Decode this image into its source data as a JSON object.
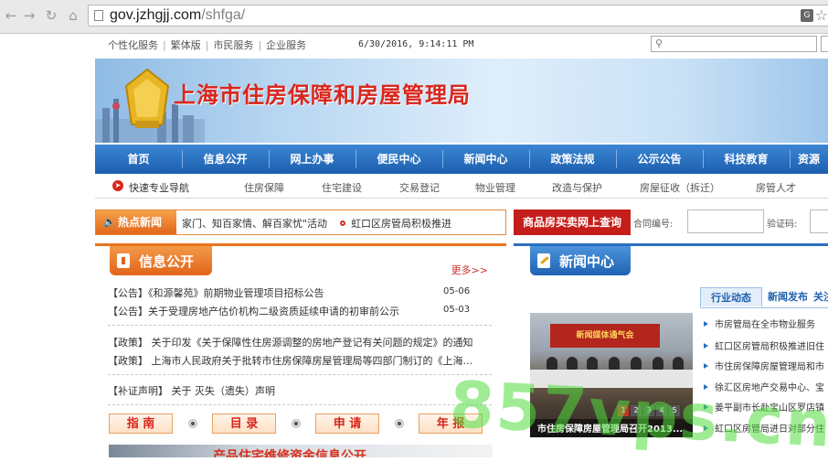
{
  "browser": {
    "url_host": "gov.jzhgjj.com",
    "url_path": "/shfga/",
    "translate_icon": "translate-icon",
    "star_icon": "star-icon"
  },
  "util": {
    "links": [
      "个性化服务",
      "繁体版",
      "市民服务",
      "企业服务"
    ],
    "date": "6/30/2016, 9:14:11 PM"
  },
  "banner": {
    "title": "上海市住房保障和房屋管理局"
  },
  "mainnav": [
    "首页",
    "信息公开",
    "网上办事",
    "便民中心",
    "新闻中心",
    "政策法规",
    "公示公告",
    "科技教育",
    "资源"
  ],
  "subnav": {
    "lead": "快速专业导航",
    "items": [
      "住房保障",
      "住宅建设",
      "交易登记",
      "物业管理",
      "改造与保护",
      "房屋征收（拆迁）",
      "房管人才"
    ]
  },
  "hot": {
    "label": "热点新闻",
    "text1": "家门、知百家情、解百家忧\"活动",
    "text2": "虹口区房管局积极推进"
  },
  "query": {
    "title": "商品房买卖网上查询",
    "contract_label": "合同编号:",
    "code_label": "验证码:"
  },
  "info": {
    "title": "信息公开",
    "more": "更多>>",
    "rows": [
      {
        "text": "【公告】《和源馨苑》前期物业管理项目招标公告",
        "date": "05-06"
      },
      {
        "text": "【公告】关于受理房地产估价机构二级资质延续申请的初审前公示",
        "date": "05-03"
      },
      {
        "text": "【政策】 关于印发《关于保障性住房源调整的房地产登记有关问题的规定》的通知",
        "date": ""
      },
      {
        "text": "【政策】 上海市人民政府关于批转市住房保障房屋管理局等四部门制订的《上海...",
        "date": ""
      },
      {
        "text": "【补证声明】 关于 灭失（遗失）声明",
        "date": ""
      }
    ],
    "buttons": [
      "指 南",
      "目 录",
      "申 请",
      "年 报"
    ],
    "banner2": "产品住宅维修资金信息公开"
  },
  "news": {
    "title": "新闻中心",
    "tabs": [
      "行业动态",
      "新闻发布",
      "关注"
    ],
    "photo_banner": "新闻媒体通气会",
    "photo_caption": "市住房保障房屋管理局召开2013...",
    "pager": [
      "1",
      "2",
      "3",
      "4",
      "5"
    ],
    "items": [
      "市房管局在全市物业服务",
      "虹口区房管局积极推进旧住",
      "市住房保障房屋管理局和市",
      "徐汇区房地产交易中心、宝",
      "姜平副市长赴宝山区罗店镇",
      "虹口区房管局进日对部分住"
    ]
  },
  "watermark": "857vps.cn"
}
